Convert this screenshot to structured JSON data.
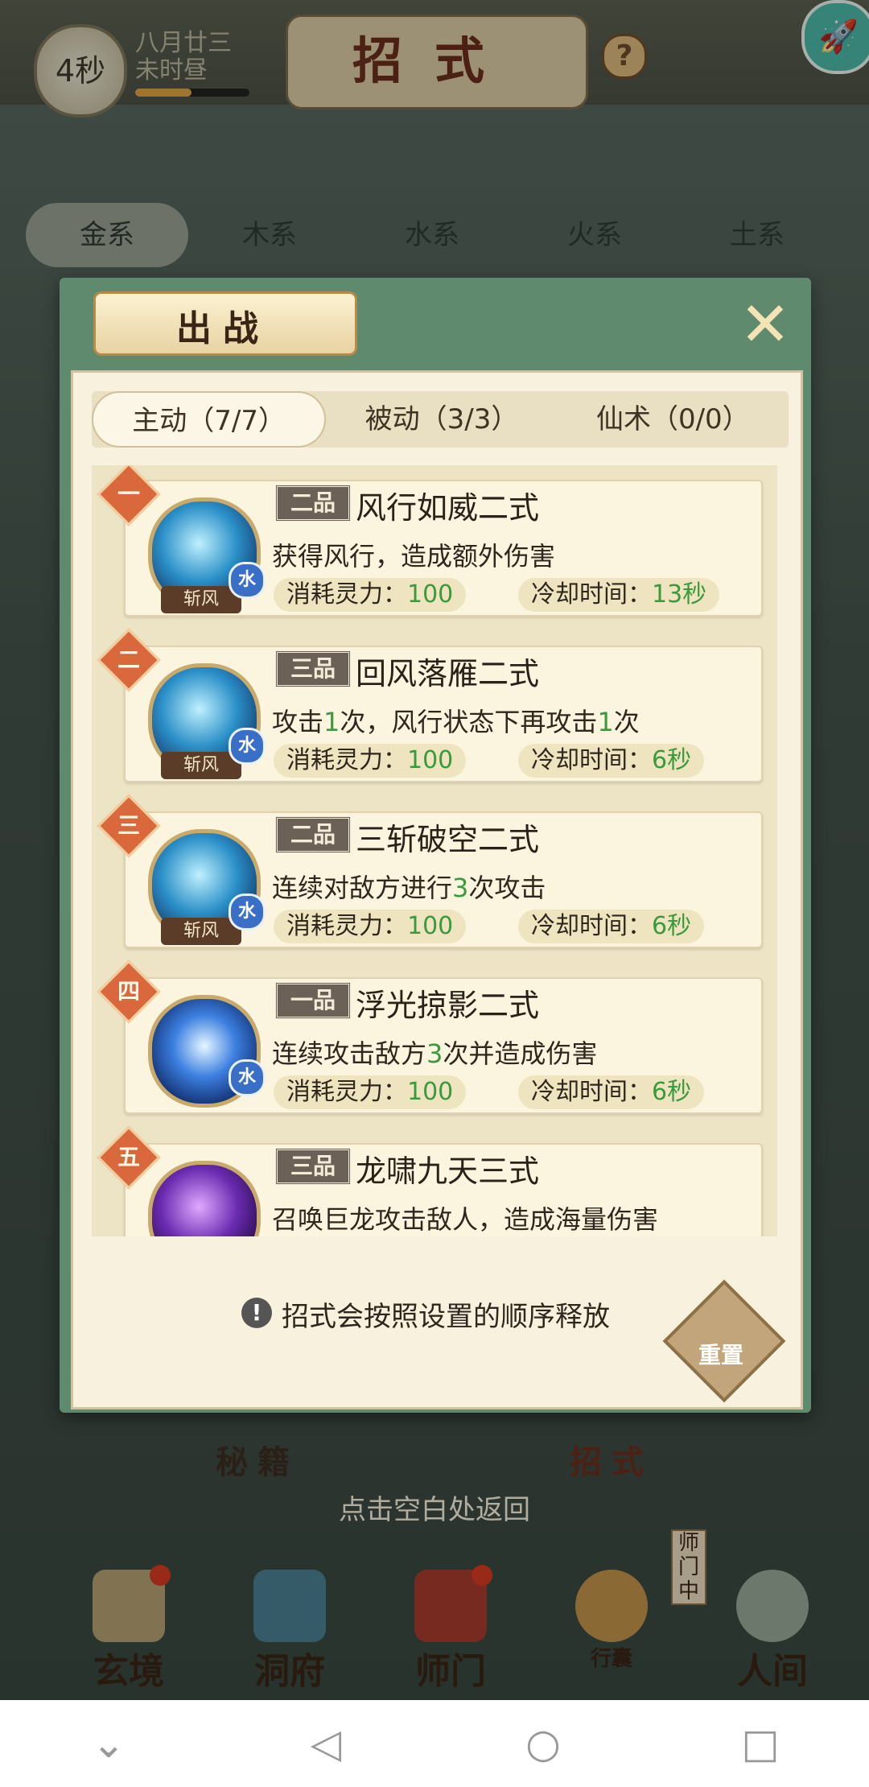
{
  "top_bar": {
    "timer": "4秒",
    "date_line1": "八月廿三",
    "date_line2": "未时昼",
    "page_title": "招式",
    "help": "?"
  },
  "element_tabs": [
    "金系",
    "木系",
    "水系",
    "火系",
    "土系"
  ],
  "dialog": {
    "title": "出战",
    "close_icon": "close-icon",
    "type_tabs": [
      {
        "label": "主动（7/7）",
        "active": true
      },
      {
        "label": "被动（3/3）",
        "active": false
      },
      {
        "label": "仙术（0/0）",
        "active": false
      }
    ],
    "skills": [
      {
        "order": "一",
        "grade": "二品",
        "name": "风行如威二式",
        "desc": "获得风行，造成额外伤害",
        "element": "水",
        "tag": "斩风",
        "cost_label": "消耗灵力：",
        "cost": "100",
        "cd_label": "冷却时间：",
        "cd": "13秒"
      },
      {
        "order": "二",
        "grade": "三品",
        "name": "回风落雁二式",
        "desc_parts": [
          "攻击",
          "1",
          "次，风行状态下再攻击",
          "1",
          "次"
        ],
        "element": "水",
        "tag": "斩风",
        "cost_label": "消耗灵力：",
        "cost": "100",
        "cd_label": "冷却时间：",
        "cd": "6秒"
      },
      {
        "order": "三",
        "grade": "二品",
        "name": "三斩破空二式",
        "desc_parts": [
          "连续对敌方进行",
          "3",
          "次攻击"
        ],
        "element": "水",
        "tag": "斩风",
        "cost_label": "消耗灵力：",
        "cost": "100",
        "cd_label": "冷却时间：",
        "cd": "6秒"
      },
      {
        "order": "四",
        "grade": "一品",
        "name": "浮光掠影二式",
        "desc_parts": [
          "连续攻击敌方",
          "3",
          "次并造成伤害"
        ],
        "element": "水",
        "cost_label": "消耗灵力：",
        "cost": "100",
        "cd_label": "冷却时间：",
        "cd": "6秒"
      },
      {
        "order": "五",
        "grade": "三品",
        "name": "龙啸九天三式",
        "desc": "召唤巨龙攻击敌人，造成海量伤害"
      }
    ],
    "order_hint": "招式会按照设置的顺序释放",
    "reset_label": "重置"
  },
  "under_tabs": [
    "秘籍",
    "招式"
  ],
  "dismiss_hint": "点击空白处返回",
  "bottom_nav": [
    {
      "label": "玄境",
      "badge": true
    },
    {
      "label": "洞府",
      "badge": false
    },
    {
      "label": "师门",
      "badge": true
    },
    {
      "label": "行囊",
      "badge": false
    },
    {
      "label": "人间",
      "badge": false
    }
  ],
  "sect_status": "师门中",
  "system_nav": {
    "back_icon": "back-icon",
    "home_icon": "home-icon",
    "recents_icon": "recents-icon",
    "collapse_icon": "chevron-down-icon"
  }
}
